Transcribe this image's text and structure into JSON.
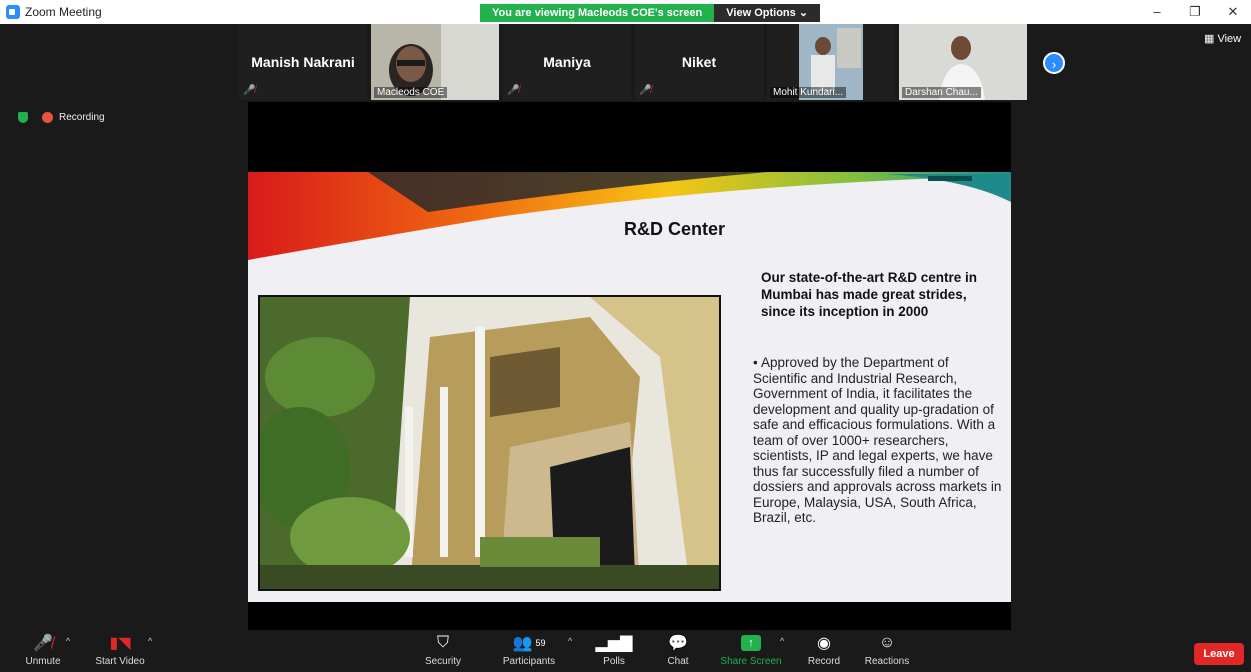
{
  "window": {
    "title": "Zoom Meeting",
    "minimize": "–",
    "restore": "❐",
    "close": "✕"
  },
  "share_banner": {
    "viewing_text": "You are viewing Macleods COE's screen",
    "view_options_label": "View Options ⌄"
  },
  "view_label": "View",
  "status": {
    "recording_label": "Recording"
  },
  "participants_strip": [
    {
      "name": "Manish Nakrani",
      "video": false,
      "muted": true
    },
    {
      "name": "Macleods COE",
      "video": true,
      "muted": false,
      "active": true
    },
    {
      "name": "Maniya",
      "video": false,
      "muted": true
    },
    {
      "name": "Niket",
      "video": false,
      "muted": true
    },
    {
      "name": "Mohit Kundari...",
      "video": true,
      "muted": true
    },
    {
      "name": "Darshan Chau...",
      "video": true,
      "muted": true
    }
  ],
  "slide": {
    "title": "R&D Center",
    "headline": "Our state-of-the-art R&D centre in Mumbai has made great strides, since its inception in 2000",
    "body": "Approved by the Department of Scientific and Industrial Research, Government of India, it facilitates the development and quality up-gradation of safe and efficacious formulations. With a team of over 1000+ researchers, scientists, IP and legal experts, we have thus far successfully filed a number of dossiers and approvals across markets in Europe, Malaysia, USA, South Africa, Brazil, etc."
  },
  "toolbar": {
    "unmute": "Unmute",
    "start_video": "Start Video",
    "security": "Security",
    "participants": "Participants",
    "participants_count": "59",
    "polls": "Polls",
    "chat": "Chat",
    "share_screen": "Share Screen",
    "record": "Record",
    "reactions": "Reactions",
    "leave": "Leave"
  },
  "colors": {
    "zoom_blue": "#2d8cff",
    "share_green": "#22b14c",
    "leave_red": "#e02828",
    "muted_red": "#e02828",
    "recording_orange": "#e8543d"
  }
}
